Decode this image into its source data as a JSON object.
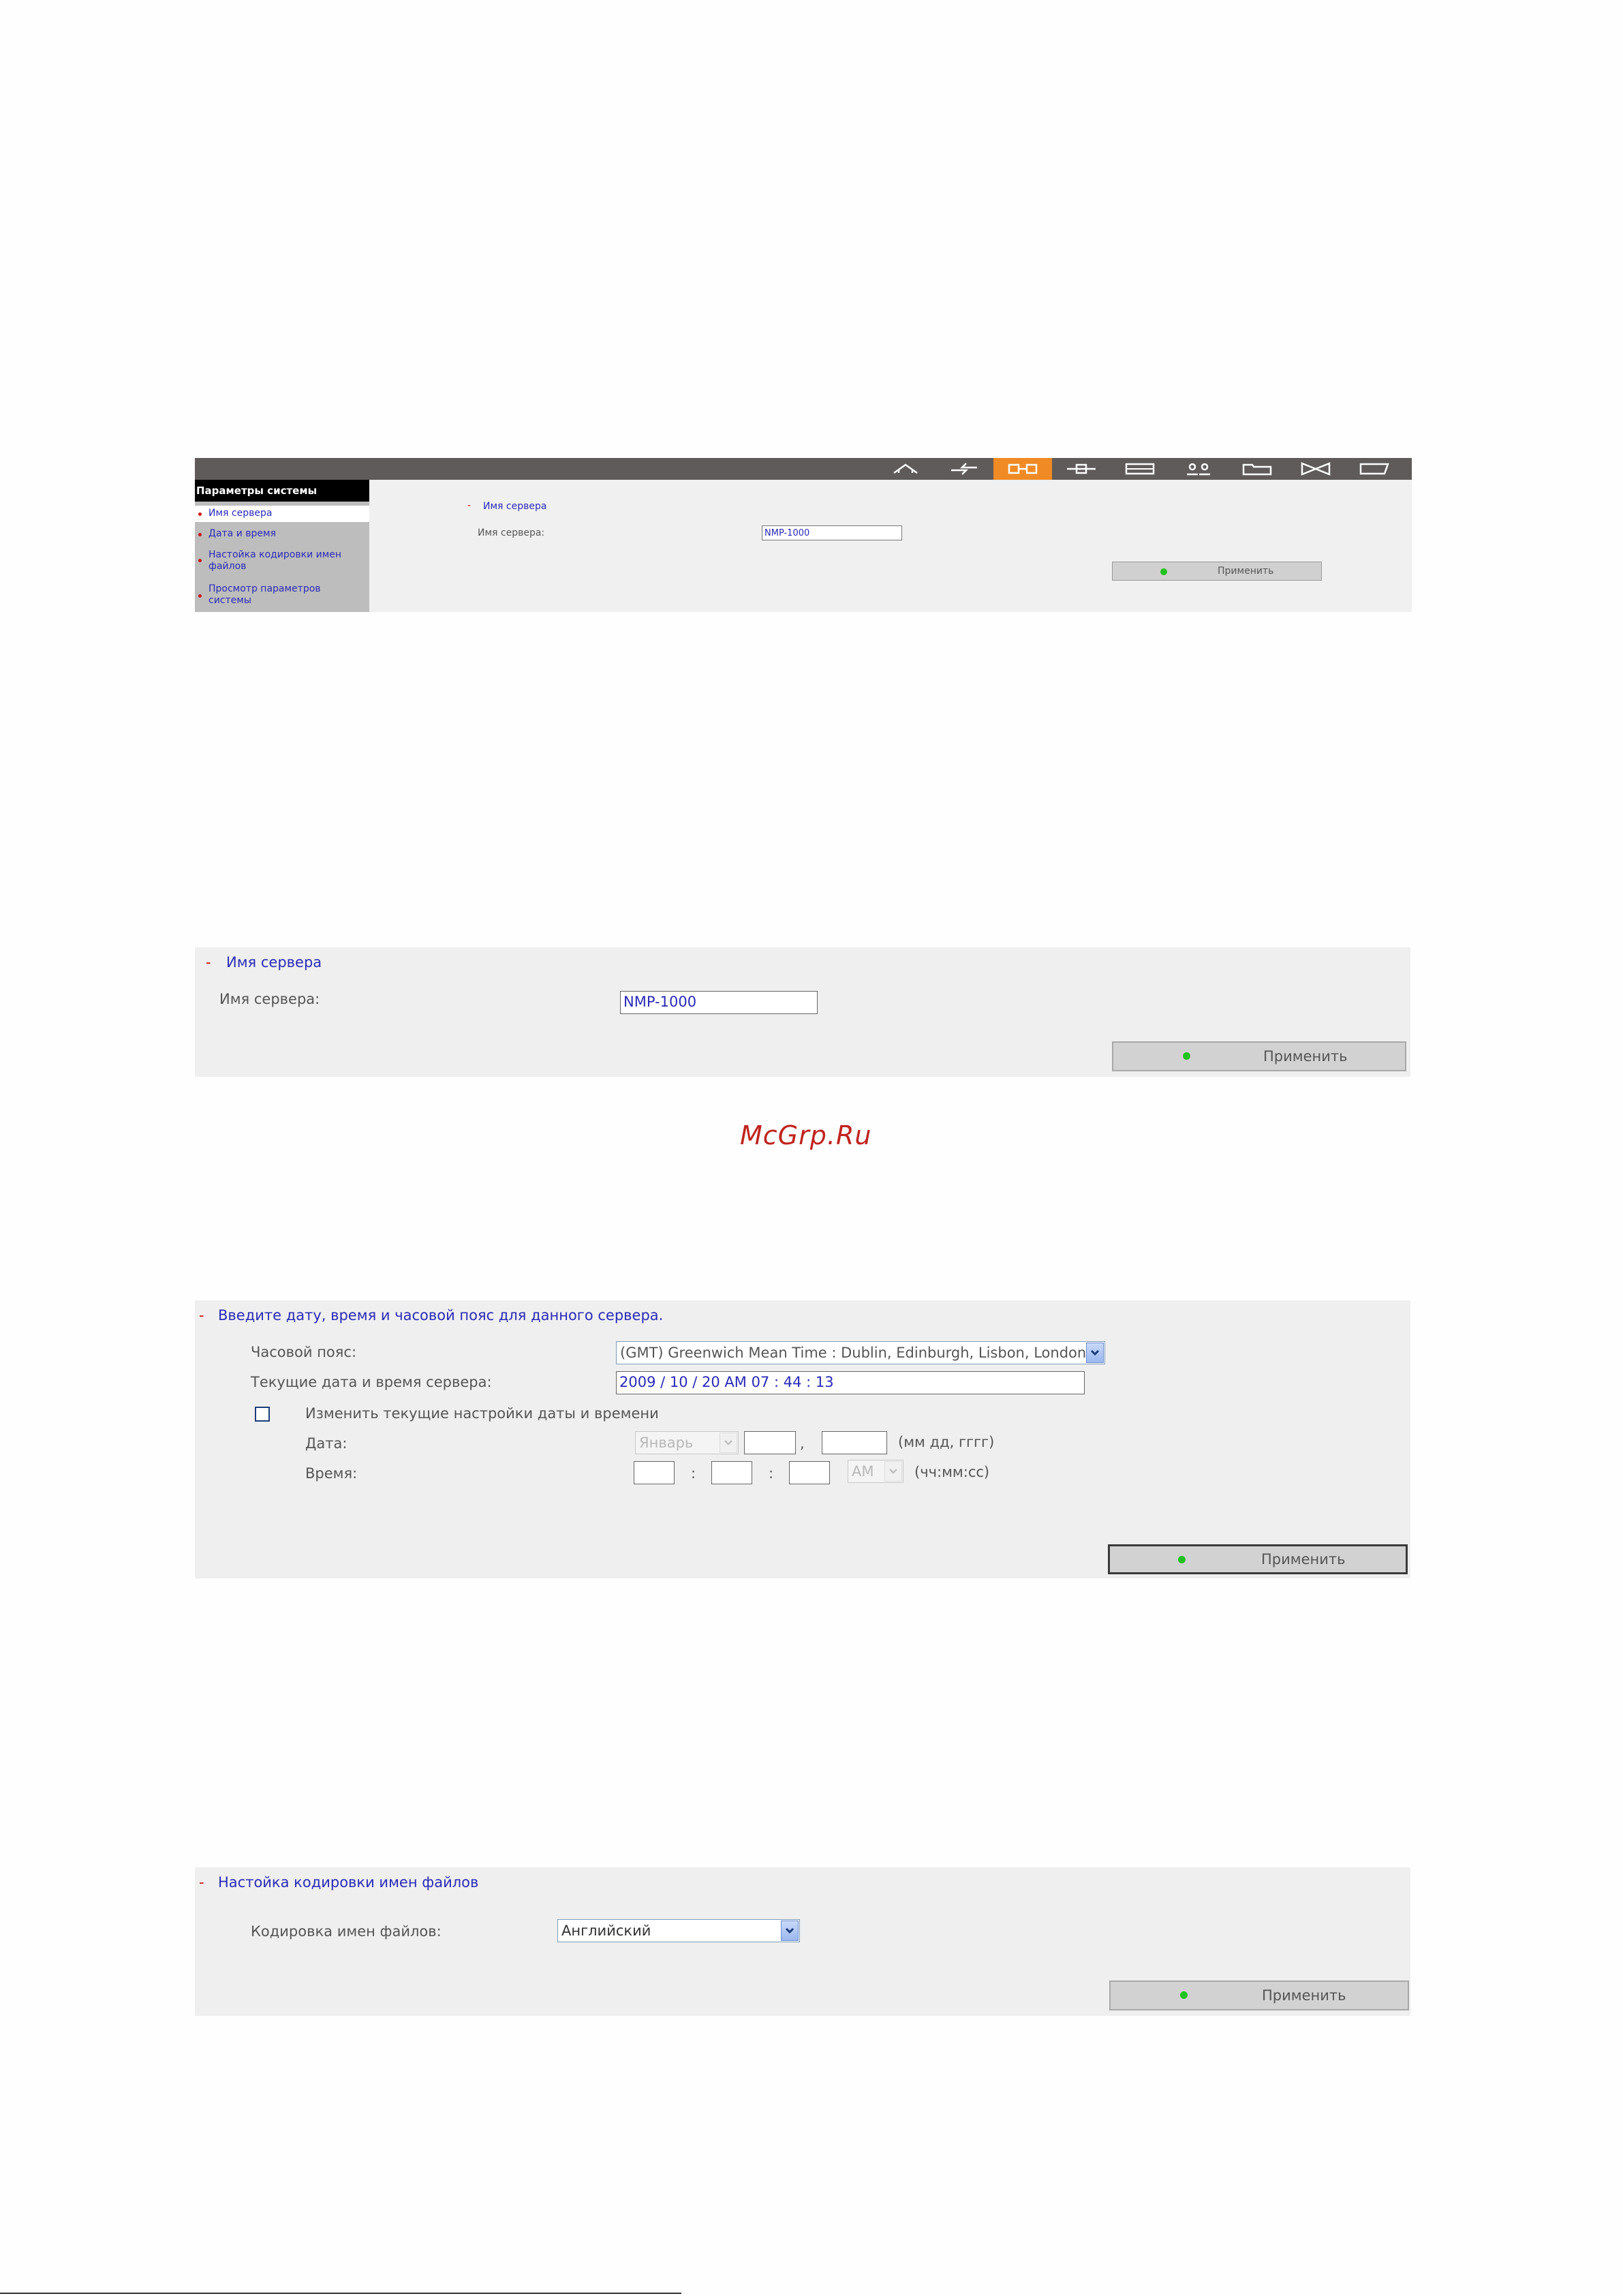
{
  "nav_icons": [
    "home-icon",
    "quick-setup-icon",
    "system-settings-icon",
    "network-icon",
    "device-icon",
    "users-icon",
    "folder-icon",
    "services-icon",
    "status-icon"
  ],
  "sidebar": {
    "title": "Параметры системы",
    "items": [
      {
        "label": "Имя сервера"
      },
      {
        "label": "Дата и время"
      },
      {
        "label": "Настойка кодировки имен файлов"
      },
      {
        "label": "Просмотр параметров системы"
      }
    ]
  },
  "server_name_panel": {
    "dash": "-",
    "title": "Имя сервера",
    "field_label": "Имя сервера:",
    "value": "NMP-1000",
    "apply": "Применить"
  },
  "watermark": "McGrp.Ru",
  "datetime_panel": {
    "dash": "-",
    "title": "Введите дату, время и часовой пояс для данного сервера.",
    "timezone_label": "Часовой пояс:",
    "timezone_value": "(GMT) Greenwich Mean Time : Dublin, Edinburgh, Lisbon, London",
    "current_label": "Текущие дата и время сервера:",
    "current_value": "2009 / 10 / 20 AM 07 : 44 : 13",
    "change_label": "Изменить текущие настройки даты и времени",
    "date_label": "Дата:",
    "month_value": "Январь",
    "date_sep": ",",
    "date_format": "(мм дд, гггг)",
    "time_label": "Время:",
    "time_sep": ":",
    "ampm_value": "AM",
    "time_format": "(чч:мм:сс)",
    "apply": "Применить"
  },
  "encoding_panel": {
    "dash": "-",
    "title": "Настойка кодировки имен файлов",
    "label": "Кодировка имен файлов:",
    "value": "Английский",
    "apply": "Применить"
  }
}
